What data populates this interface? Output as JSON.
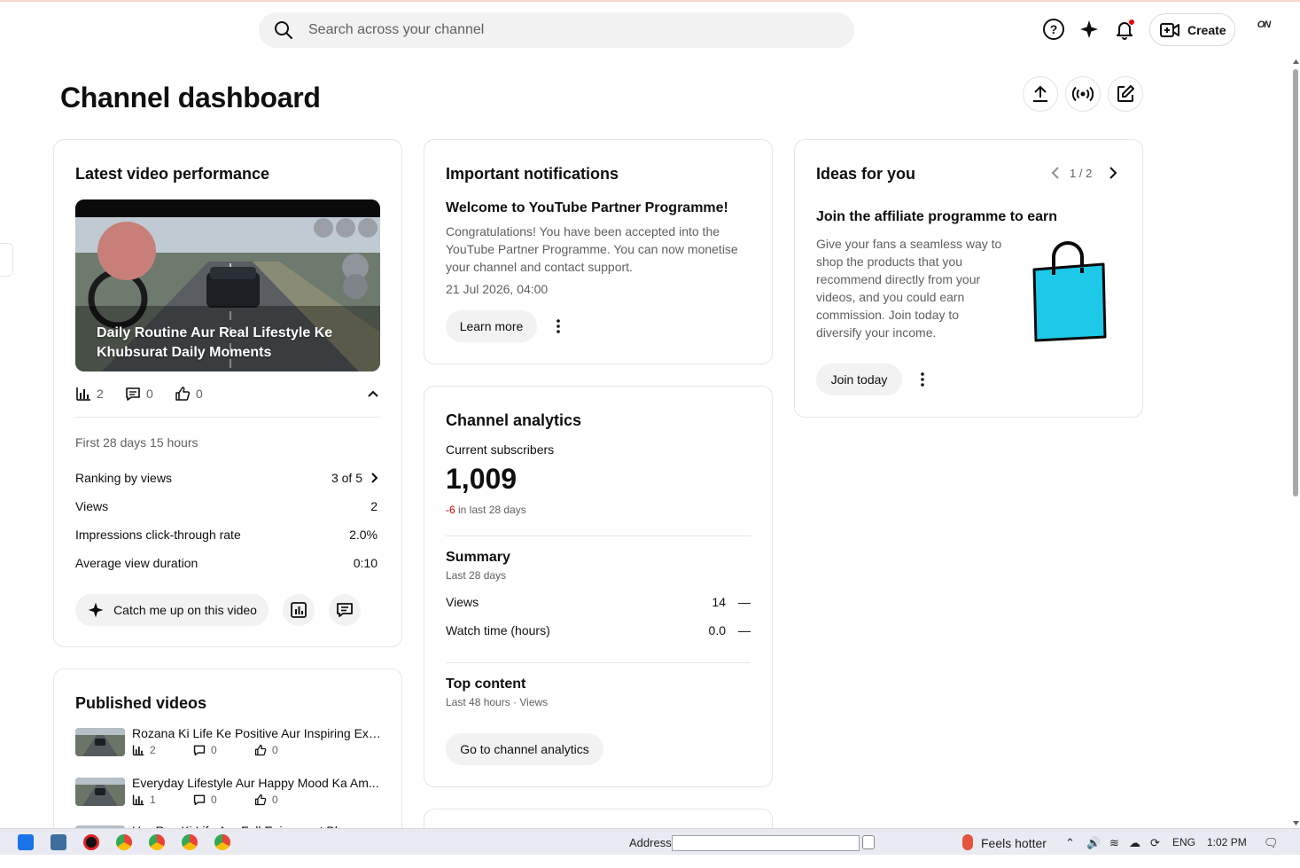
{
  "search": {
    "placeholder": "Search across your channel"
  },
  "header": {
    "create_label": "Create",
    "avatar_text": "ON"
  },
  "page_title": "Channel dashboard",
  "latest_video": {
    "heading": "Latest video performance",
    "video_title": "Daily Routine Aur Real Lifestyle Ke Khubsurat Daily Moments",
    "views_count": "2",
    "comments_count": "0",
    "likes_count": "0",
    "period": "First 28 days 15 hours",
    "ranking_label": "Ranking by views",
    "ranking_value": "3 of 5",
    "views_label": "Views",
    "views_value": "2",
    "ctr_label": "Impressions click-through rate",
    "ctr_value": "2.0%",
    "avd_label": "Average view duration",
    "avd_value": "0:10",
    "catch_up_label": "Catch me up on this video"
  },
  "notifications": {
    "heading": "Important notifications",
    "title": "Welcome to YouTube Partner Programme!",
    "body": "Congratulations! You have been accepted into the YouTube Partner Programme. You can now monetise your channel and contact support.",
    "date": "21 Jul 2026, 04:00",
    "learn_more_label": "Learn more"
  },
  "ideas": {
    "heading": "Ideas for you",
    "pager": "1 / 2",
    "title": "Join the affiliate programme to earn",
    "body": "Give your fans a seamless way to shop the products that you recommend directly from your videos, and you could earn commission. Join today to diversify your income.",
    "join_label": "Join today",
    "accent_color": "#1ec8e8"
  },
  "analytics": {
    "heading": "Channel analytics",
    "subscribers_label": "Current subscribers",
    "subscribers_value": "1,009",
    "change_value": "-6",
    "change_period": " in last 28 days",
    "summary_heading": "Summary",
    "summary_period": "Last 28 days",
    "views_label": "Views",
    "views_value": "14",
    "views_trend": "—",
    "watch_label": "Watch time (hours)",
    "watch_value": "0.0",
    "watch_trend": "—",
    "top_heading": "Top content",
    "top_period": "Last 48 hours · Views",
    "go_label": "Go to channel analytics",
    "negative_color": "#cc0000"
  },
  "published": {
    "heading": "Published videos",
    "videos": [
      {
        "title": "Rozana Ki Life Ke Positive Aur Inspiring Exp...",
        "views": "2",
        "comments": "0",
        "likes": "0"
      },
      {
        "title": "Everyday Lifestyle Aur Happy Mood Ka Am...",
        "views": "1",
        "comments": "0",
        "likes": "0"
      },
      {
        "title": "Har Roz Ki Life Aur Full Enjoyment Bhara Lif...",
        "views": "",
        "comments": "",
        "likes": ""
      }
    ]
  },
  "taskbar": {
    "address_label": "Address",
    "weather": "Feels hotter",
    "language": "ENG",
    "time": "1:02 PM"
  }
}
